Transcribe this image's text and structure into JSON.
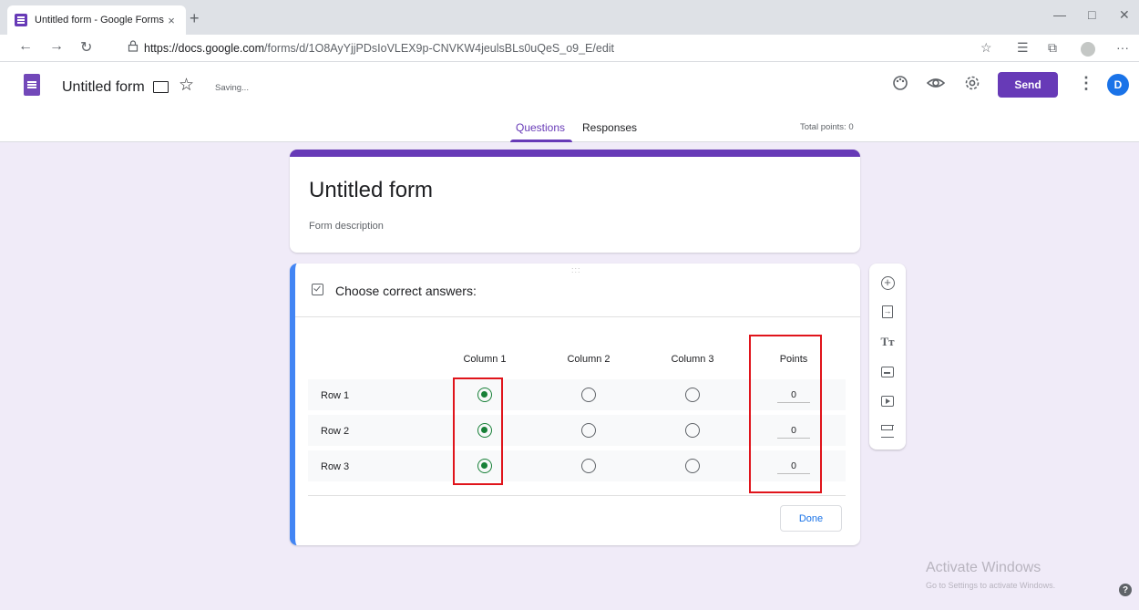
{
  "browser": {
    "tab_title": "Untitled form - Google Forms",
    "tab_close": "×",
    "new_tab": "+",
    "url_host": "https://docs.google.com",
    "url_path": "/forms/d/1O8AyYjjPDsIoVLEX9p-CNVKW4jeulsBLs0uQeS_o9_E/edit",
    "back": "←",
    "forward": "→",
    "refresh": "↻",
    "lock": "🔒",
    "window_minimize": "—",
    "window_maximize": "□",
    "window_close": "✕",
    "more": "···"
  },
  "header": {
    "doc_title": "Untitled form",
    "star": "☆",
    "status": "Saving...",
    "send_label": "Send",
    "more": "⋮",
    "avatar_initial": "D",
    "tabs": [
      {
        "label": "Questions",
        "active": true
      },
      {
        "label": "Responses",
        "active": false
      }
    ],
    "total_points": "Total points: 0",
    "accent_color": "#673ab7"
  },
  "form": {
    "title": "Untitled form",
    "description": "Form description"
  },
  "question": {
    "drag_handle": ":::",
    "heading": "Choose correct answers:",
    "columns": [
      "Column 1",
      "Column 2",
      "Column 3"
    ],
    "points_header": "Points",
    "rows": [
      {
        "label": "Row 1",
        "selected_column": 1,
        "points": "0"
      },
      {
        "label": "Row 2",
        "selected_column": 1,
        "points": "0"
      },
      {
        "label": "Row 3",
        "selected_column": 1,
        "points": "0"
      }
    ],
    "done_label": "Done",
    "correct_color": "#188038",
    "highlight_color": "#e0141b"
  },
  "toolbar": {
    "items": [
      {
        "name": "add-question",
        "icon": "plus-circle-icon",
        "glyph": "+"
      },
      {
        "name": "import-questions",
        "icon": "import-icon",
        "glyph": "→"
      },
      {
        "name": "add-title",
        "icon": "text-icon",
        "glyph": "Tт"
      },
      {
        "name": "add-image",
        "icon": "image-icon",
        "glyph": ""
      },
      {
        "name": "add-video",
        "icon": "video-icon",
        "glyph": ""
      },
      {
        "name": "add-section",
        "icon": "section-icon",
        "glyph": ""
      }
    ]
  },
  "watermark": {
    "title": "Activate Windows",
    "subtitle": "Go to Settings to activate Windows."
  },
  "help": "?"
}
